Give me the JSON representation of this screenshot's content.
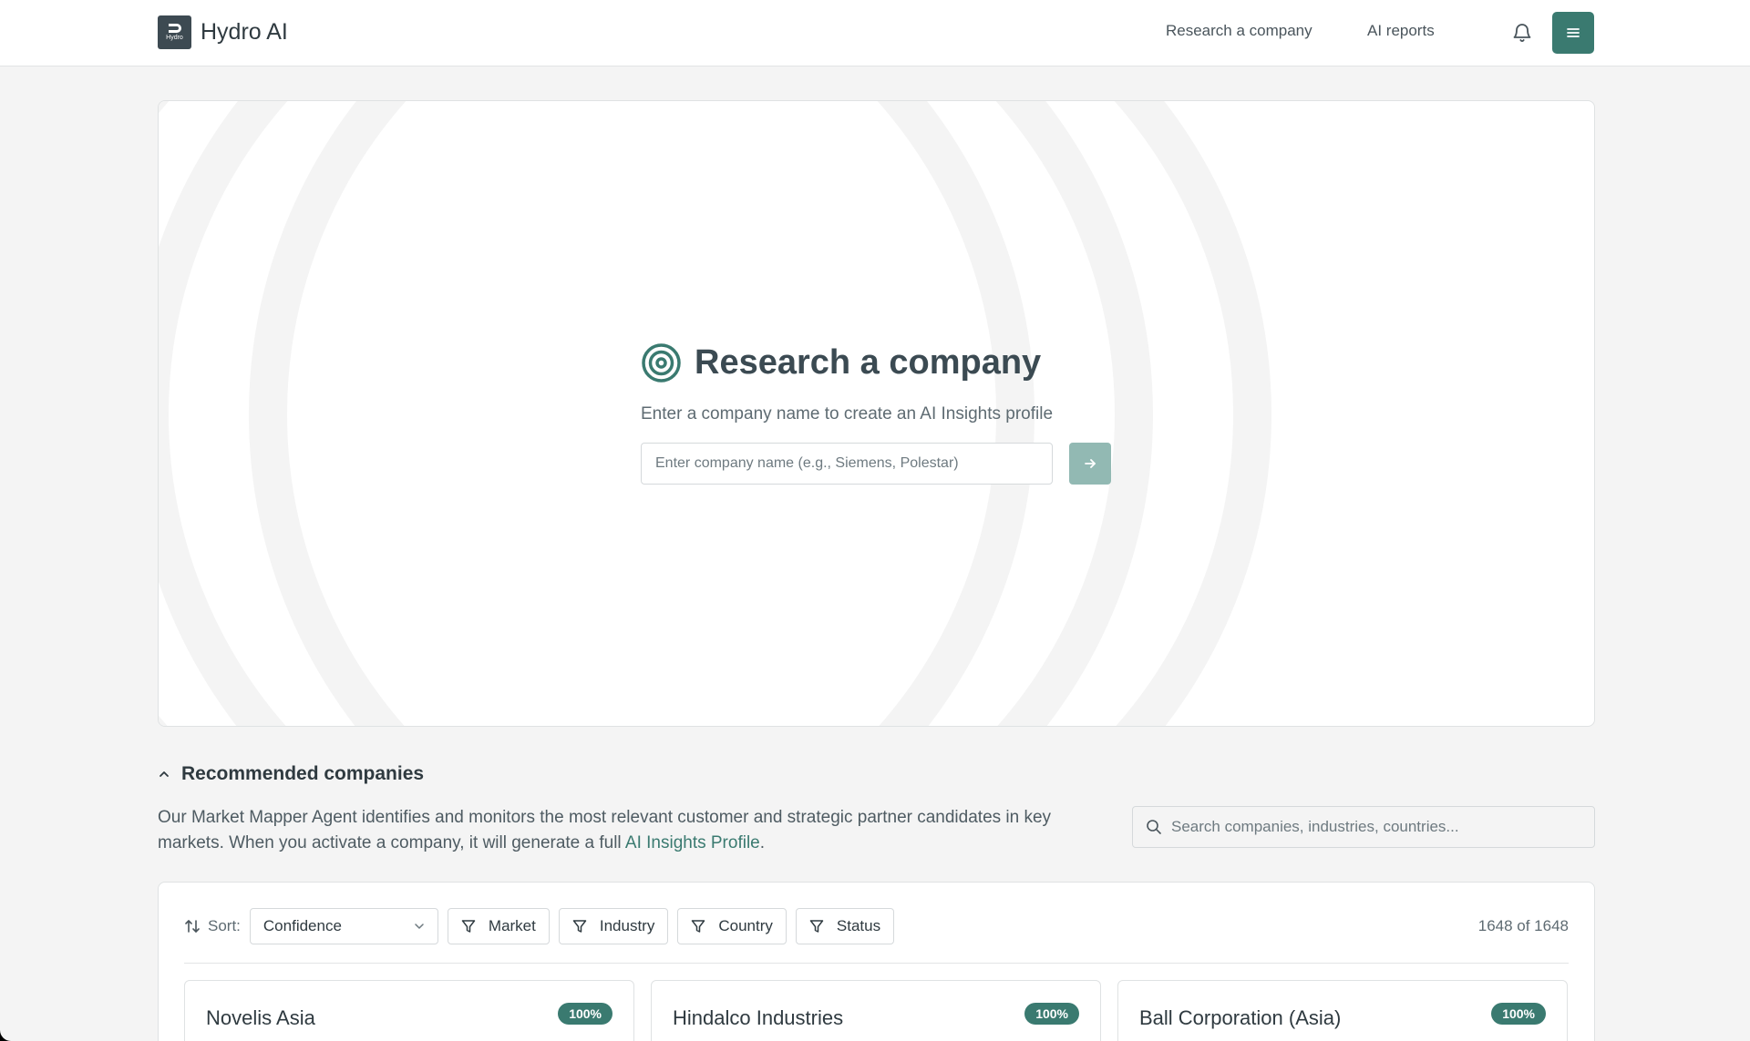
{
  "header": {
    "brand_name": "Hydro AI",
    "logo_text": "Hydro",
    "nav": [
      {
        "label": "Research a company"
      },
      {
        "label": "AI reports"
      }
    ],
    "bell_icon": "bell-icon",
    "menu_icon": "hamburger-menu-icon",
    "accent_color": "#3a7a70"
  },
  "hero": {
    "icon": "target-icon",
    "title": "Research a company",
    "subtitle": "Enter a company name to create an AI Insights profile",
    "input_placeholder": "Enter company name (e.g., Siemens, Polestar)",
    "input_value": "",
    "submit_icon": "arrow-right-icon"
  },
  "recommended": {
    "title": "Recommended companies",
    "description_prefix": "Our Market Mapper Agent identifies and monitors the most relevant customer and strategic partner candidates in key markets. When you activate a company, it will generate a full ",
    "description_link": "AI Insights Profile",
    "description_suffix": ".",
    "search_placeholder": "Search companies, industries, countries..."
  },
  "list": {
    "sort_label": "Sort:",
    "sort_value": "Confidence",
    "filters": [
      {
        "label": "Market"
      },
      {
        "label": "Industry"
      },
      {
        "label": "Country"
      },
      {
        "label": "Status"
      }
    ],
    "count": "1648 of 1648",
    "companies": [
      {
        "name": "Novelis Asia",
        "confidence": "100%"
      },
      {
        "name": "Hindalco Industries",
        "confidence": "100%"
      },
      {
        "name": "Ball Corporation (Asia)",
        "confidence": "100%"
      }
    ]
  }
}
